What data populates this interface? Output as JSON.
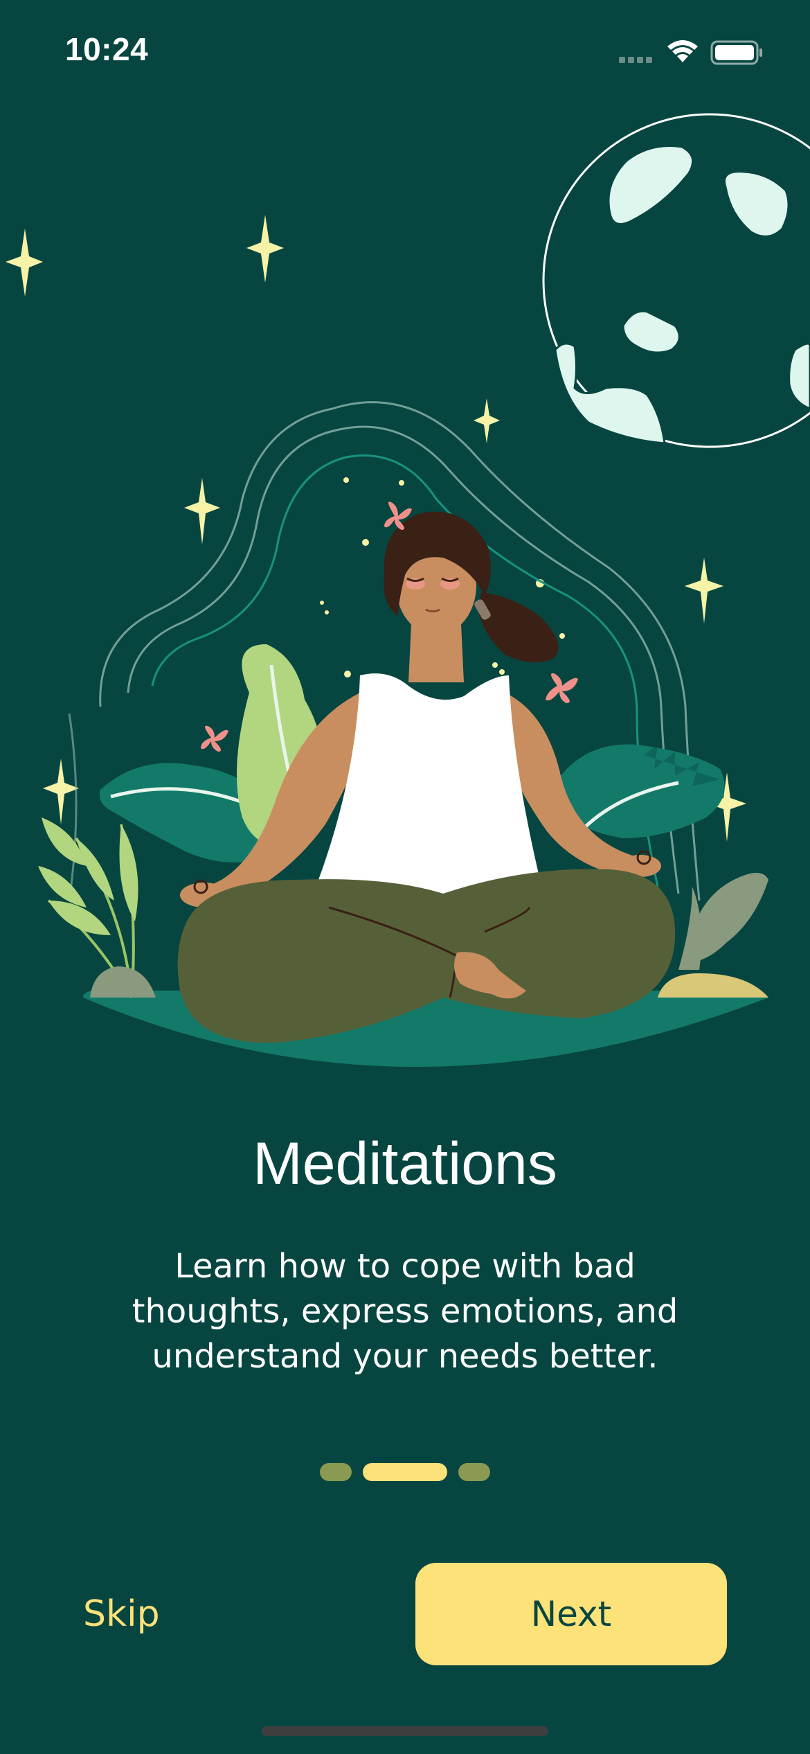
{
  "status_bar": {
    "time": "10:24",
    "icons": [
      "signal-icon",
      "wifi-icon",
      "battery-icon"
    ]
  },
  "illustration": {
    "subject": "meditating-woman-illustration",
    "elements": [
      "planet-icon",
      "sparkle-icon",
      "leaf-icon",
      "butterfly-icon"
    ]
  },
  "content": {
    "title": "Meditations",
    "description": "Learn how to cope with bad thoughts, express emotions, and understand your needs better."
  },
  "pager": {
    "total": 3,
    "active_index": 1
  },
  "actions": {
    "skip_label": "Skip",
    "next_label": "Next"
  },
  "colors": {
    "background": "#074640",
    "accent": "#fde179",
    "inactive_dot": "#8a9a52",
    "text": "#ffffff"
  }
}
